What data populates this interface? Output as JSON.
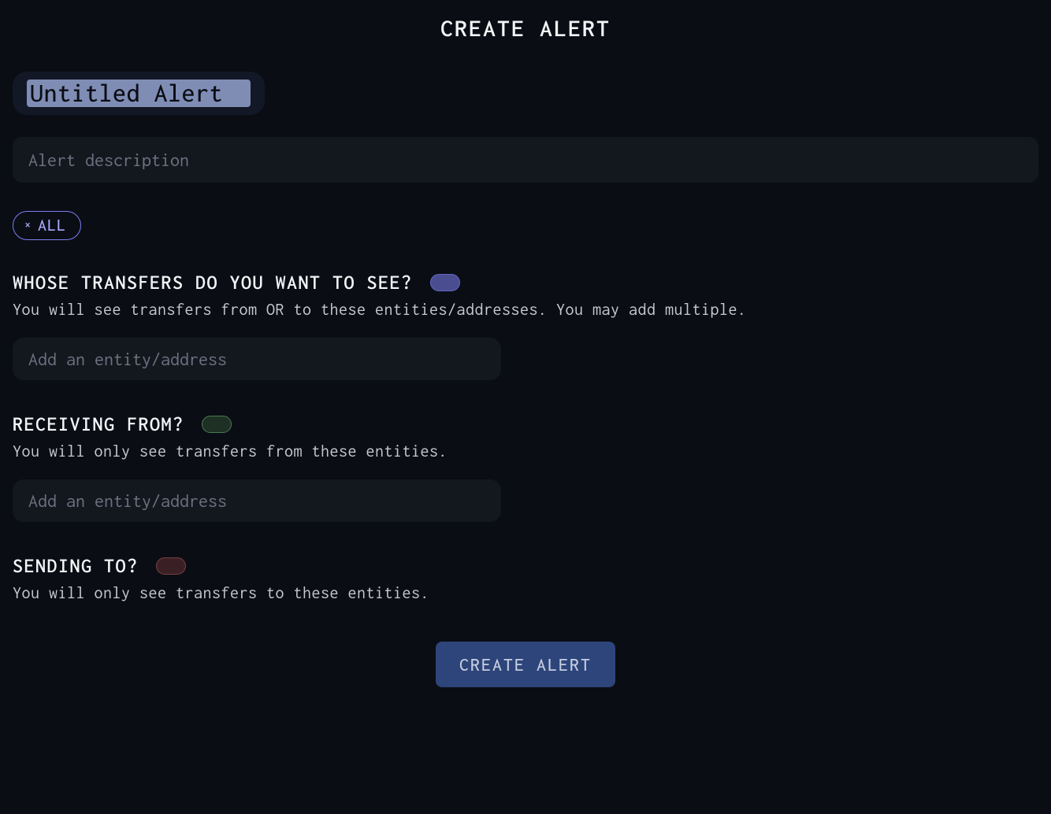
{
  "header": {
    "title": "CREATE ALERT"
  },
  "alert_name": {
    "value": "Untitled Alert"
  },
  "description": {
    "placeholder": "Alert description"
  },
  "filter_chip": {
    "label": "ALL"
  },
  "sections": {
    "whose": {
      "title": "WHOSE TRANSFERS DO YOU WANT TO SEE?",
      "description": "You will see transfers from OR to these entities/addresses. You may add multiple.",
      "input_placeholder": "Add an entity/address"
    },
    "receiving": {
      "title": "RECEIVING FROM?",
      "description": "You will only see transfers from these entities.",
      "input_placeholder": "Add an entity/address"
    },
    "sending": {
      "title": "SENDING TO?",
      "description": "You will only see transfers to these entities."
    }
  },
  "submit": {
    "label": "CREATE ALERT"
  }
}
